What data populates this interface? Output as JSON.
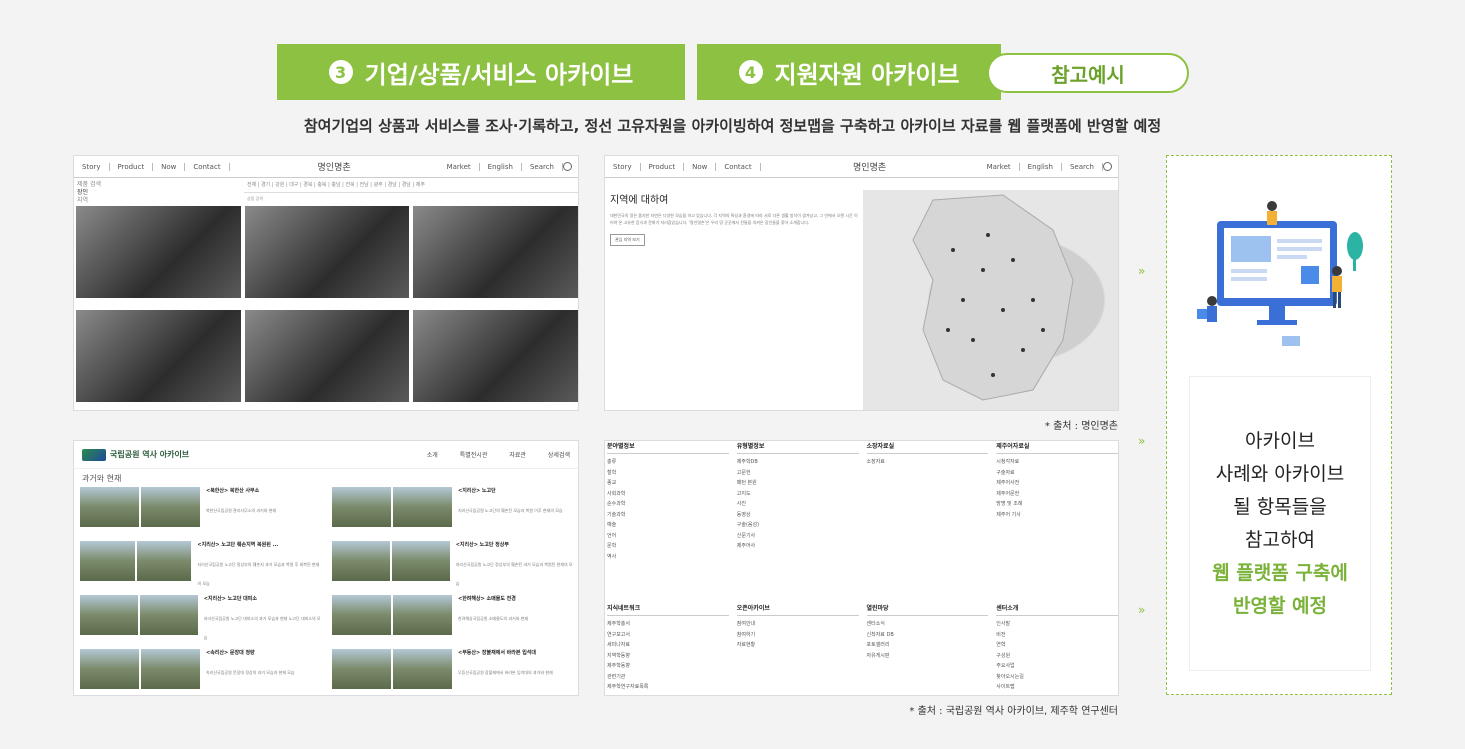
{
  "header": {
    "tab3": {
      "num": "3",
      "label": "기업/상품/서비스 아카이브"
    },
    "tab4": {
      "num": "4",
      "label": "지원자원 아카이브"
    },
    "pill": "참고예시",
    "subtitle": "참여기업의 상품과 서비스를 조사·기록하고, 정선 고유자원을 아카이빙하여 정보맵을 구축하고 아카이브 자료를 웹 플랫폼에 반영할 예정"
  },
  "panel1": {
    "nav": [
      "Story",
      "Product",
      "Now",
      "Contact"
    ],
    "logo": "명인명촌",
    "nav_right": [
      "Market",
      "English",
      "Search"
    ],
    "left_list": [
      "제품 검색",
      "장인",
      "지역"
    ],
    "cats": "전체 | 경기 | 강원 | 대구 | 경북 | 충북 | 충남 | 전북 | 전남 | 광주 | 경남 | 경남 | 제주",
    "filter": "상품 검색"
  },
  "panel2": {
    "nav": [
      "Story",
      "Product",
      "Now",
      "Contact"
    ],
    "logo": "명인명촌",
    "nav_right": [
      "Market",
      "English",
      "Search"
    ],
    "title": "지역에 대하여",
    "body": "대한민국의 땅은 좁지만 자연은 다양한 모습을 하고 있습니다. 각 지역의 특성과 환경에 따라 서로 다른 생활 방식이 생겨났고, 그 안에서 오랜 시간 이어져 온 고유한 음식과 문화가 자리잡았습니다. '명인명촌'은 우리 땅 곳곳에서 전통을 지켜온 장인들을 찾아 소개합니다.",
    "button": "관심 지역 보기"
  },
  "credit1": "* 출처 : 명인명촌",
  "panel3": {
    "logo": "국립공원 역사 아카이브",
    "nav": [
      "소개",
      "특별전시관",
      "자료관",
      "상세검색"
    ],
    "section": "과거와 현재",
    "items": [
      {
        "title": "<북한산> 북한산 사무소",
        "desc": "북한산국립공원 관리사무소의 과거와 현재"
      },
      {
        "title": "<지리산> 노고단",
        "desc": "지리산국립공원 노고단의 훼손전 모습과 복원 이후 현재의 모습"
      },
      {
        "title": "<지리산> 노고단 훼손지역 복원된 ...",
        "desc": "지리산국립공원 노고단 정상부의 훼손지 과거 모습과 복원 후 회복된 현재의 모습"
      },
      {
        "title": "<지리산> 노고단 정상부",
        "desc": "지리산국립공원 노고단 정상부의 훼손된 과거 모습과 복원된 현재의 모습"
      },
      {
        "title": "<지리산> 노고단 대피소",
        "desc": "지리산국립공원 노고단 대피소의 과거 모습과 현재 노고단 대피소의 모습"
      },
      {
        "title": "<한려해상> 소매물도 전경",
        "desc": "한려해상국립공원 소매물도의 과거와 현재"
      },
      {
        "title": "<속리산> 문장대 정량",
        "desc": "속리산국립공원 문장대 정상의 과거 모습과 현재 모습"
      },
      {
        "title": "<무등산> 장불재에서 바라본 입석대",
        "desc": "무등산국립공원 장불재에서 바라본 입석대의 과거와 현재"
      }
    ]
  },
  "panel4": {
    "cols1": [
      {
        "h": "분야별정보",
        "items": [
          "총류",
          "철학",
          "종교",
          "사회과학",
          "순수과학",
          "기술과학",
          "예술",
          "언어",
          "문학",
          "역사"
        ]
      },
      {
        "h": "유형별정보",
        "items": [
          "제주학DB",
          "고문헌",
          "패턴 본원",
          "고지도",
          "사진",
          "동영상",
          "구술(음성)",
          "신문기사",
          "제주어사"
        ]
      },
      {
        "h": "소장자료실",
        "items": [
          "소장자료"
        ]
      },
      {
        "h": "제주어자료실",
        "items": [
          "시청각자료",
          "구술자료",
          "제주어사전",
          "제주어문헌",
          "방명 및 조례",
          "제주어 기사"
        ]
      }
    ],
    "cols2": [
      {
        "h": "지식네트워크",
        "items": [
          "제주학총서",
          "연구보고서",
          "세미나자료",
          "지역학동향",
          "제주학동향",
          "관련기관",
          "제주학연구자료목록"
        ]
      },
      {
        "h": "오픈아카이브",
        "items": [
          "참여안내",
          "참여하기",
          "자료현황"
        ]
      },
      {
        "h": "열린마당",
        "items": [
          "센터소식",
          "신착자료 DB",
          "포토갤러리",
          "자유게시판"
        ]
      },
      {
        "h": "센터소개",
        "items": [
          "인사말",
          "비전",
          "연혁",
          "구성원",
          "주요사업",
          "찾아오시는길",
          "사이트맵"
        ]
      }
    ]
  },
  "credit2": "* 출처 : 국립공원 역사 아카이브, 제주학 연구센터",
  "right": {
    "lines": [
      "아카이브",
      "사례와 아카이브",
      "될 항목들을",
      "참고하여"
    ],
    "green_lines": [
      "웹 플랫폼 구축에",
      "반영할 예정"
    ]
  },
  "colors": {
    "accent": "#8dc141",
    "accent_text": "#7ab23a"
  }
}
